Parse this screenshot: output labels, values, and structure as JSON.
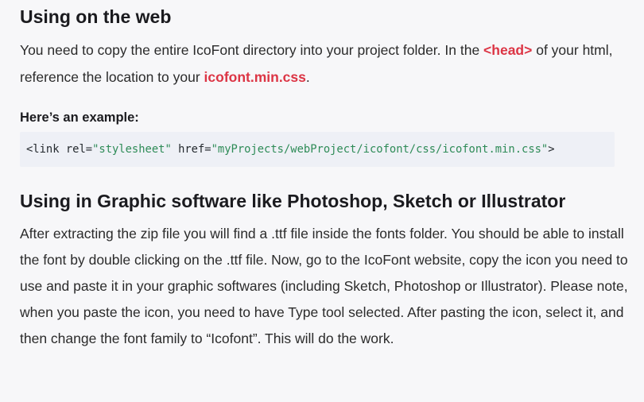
{
  "section_web": {
    "heading": "Using on the web",
    "para_before_head": "You need to copy the entire IcoFont directory into your project folder. In the ",
    "head_tag": "<head>",
    "para_mid": " of your html, reference the location to your ",
    "css_file": "icofont.min.css",
    "para_end": ".",
    "example_label": "Here’s an example:",
    "code": {
      "open": "<link ",
      "rel_attr": "rel=",
      "rel_val": "\"stylesheet\"",
      "href_attr": " href=",
      "href_val": "\"myProjects/webProject/icofont/css/icofont.min.css\"",
      "close": ">"
    }
  },
  "section_graphic": {
    "heading": "Using in Graphic software like Photoshop, Sketch or Illustrator",
    "paragraph": "After extracting the zip file you will find a .ttf file inside the fonts folder. You should be able to install the font by double clicking on the .ttf file. Now, go to the IcoFont website, copy the icon you need to use and paste it in your graphic softwares (including Sketch, Photoshop or Illustrator). Please note, when you paste the icon, you need to have Type tool selected. After pasting the icon, select it, and then change the font family to “Icofont”. This will do the work."
  }
}
